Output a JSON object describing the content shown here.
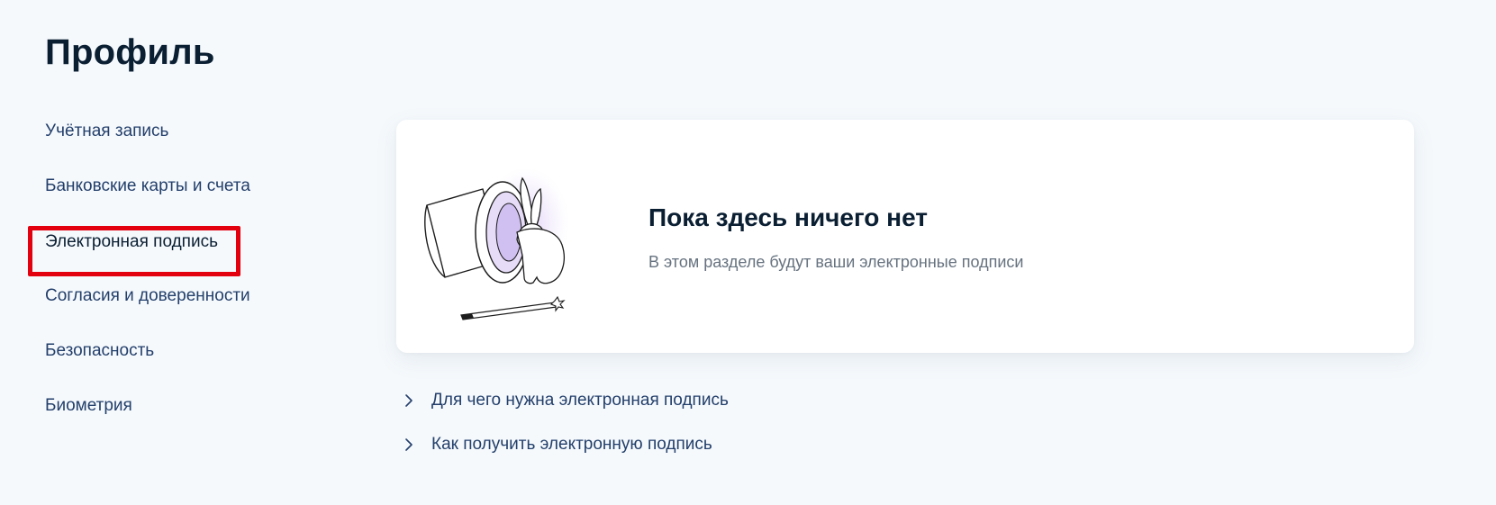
{
  "page": {
    "title": "Профиль"
  },
  "sidebar": {
    "items": [
      {
        "label": "Учётная запись"
      },
      {
        "label": "Банковские карты и счета"
      },
      {
        "label": "Электронная подпись",
        "active": true
      },
      {
        "label": "Согласия и доверенности"
      },
      {
        "label": "Безопасность"
      },
      {
        "label": "Биометрия"
      }
    ]
  },
  "empty_state": {
    "title": "Пока здесь ничего нет",
    "subtitle": "В этом разделе будут ваши электронные подписи",
    "illustration": "magic-hat-rabbit-illustration"
  },
  "faq": {
    "items": [
      {
        "label": "Для чего нужна электронная подпись",
        "icon": "chevron-right-icon"
      },
      {
        "label": "Как получить электронную подпись",
        "icon": "chevron-right-icon"
      }
    ]
  },
  "colors": {
    "background": "#f5f9fc",
    "card": "#ffffff",
    "title": "#0b1f33",
    "link": "#233f6b",
    "muted": "#66727f",
    "highlight": "#e3000f"
  }
}
